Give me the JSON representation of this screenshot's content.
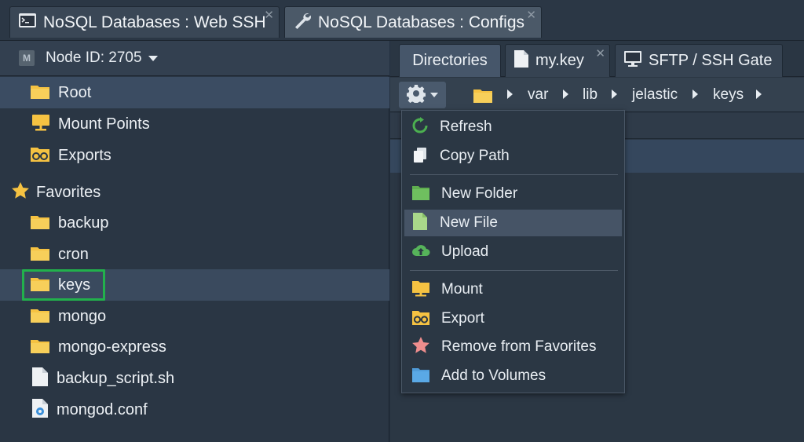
{
  "top_tabs": [
    {
      "label": "NoSQL Databases : Web SSH",
      "icon": "terminal-icon",
      "active": false
    },
    {
      "label": "NoSQL Databases : Configs",
      "icon": "wrench-icon",
      "active": true
    }
  ],
  "node_selector": {
    "badge": "M",
    "label": "Node ID: 2705"
  },
  "tree": {
    "root": "Root",
    "mount_points": "Mount Points",
    "exports": "Exports",
    "favorites": "Favorites",
    "items": [
      "backup",
      "cron",
      "keys",
      "mongo",
      "mongo-express",
      "backup_script.sh",
      "mongod.conf"
    ]
  },
  "sub_tabs": [
    {
      "label": "Directories",
      "active": true
    },
    {
      "label": "my.key",
      "icon": "file-icon"
    },
    {
      "label": "SFTP / SSH Gate",
      "icon": "monitor-icon"
    }
  ],
  "breadcrumb": [
    "var",
    "lib",
    "jelastic",
    "keys"
  ],
  "context_menu": {
    "refresh": "Refresh",
    "copy_path": "Copy Path",
    "new_folder": "New Folder",
    "new_file": "New File",
    "upload": "Upload",
    "mount": "Mount",
    "export": "Export",
    "remove_favorites": "Remove from Favorites",
    "add_volumes": "Add to Volumes"
  },
  "colors": {
    "folder": "#f5c242",
    "highlight": "#22b14c",
    "refresh": "#4caf50",
    "new_folder": "#6fbf5f",
    "new_file": "#a9d88a",
    "upload": "#56b35a",
    "remove_favorites": "#ef8d8d",
    "add_volumes": "#5aa9e6",
    "star": "#f5c242"
  }
}
